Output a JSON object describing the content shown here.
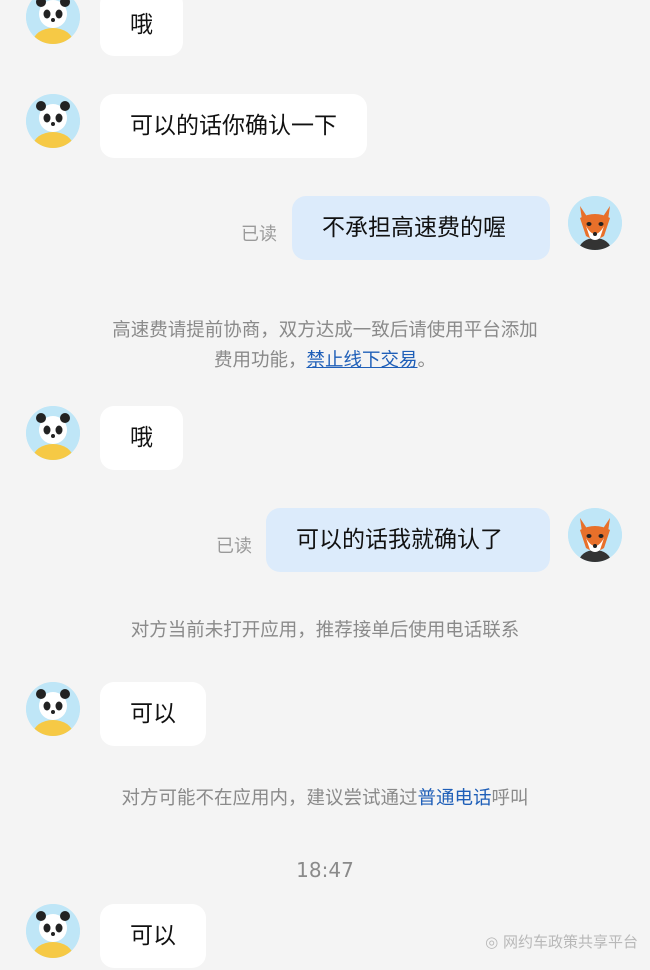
{
  "messages": {
    "m1": {
      "text": "哦"
    },
    "m2": {
      "text": "可以的话你确认一下"
    },
    "m3": {
      "text": "不承担高速费的喔",
      "status": "已读"
    },
    "m4": {
      "text": "哦"
    },
    "m5": {
      "text": "可以的话我就确认了",
      "status": "已读"
    },
    "m6": {
      "text": "可以"
    },
    "m7": {
      "text": "可以"
    }
  },
  "notices": {
    "n1": {
      "line1": "高速费请提前协商，双方达成一致后请使用平台添加",
      "line2_prefix": "费用功能，",
      "line2_link": "禁止线下交易",
      "line2_suffix": "。"
    },
    "n2": {
      "text": "对方当前未打开应用，推荐接单后使用电话联系"
    },
    "n3": {
      "prefix": "对方可能不在应用内，建议尝试通过",
      "link": "普通电话",
      "suffix": "呼叫"
    }
  },
  "timestamp": "18:47",
  "watermark": "网约车政策共享平台",
  "icons": {
    "incoming_avatar": "panda-avatar-icon",
    "outgoing_avatar": "fox-avatar-icon"
  },
  "colors": {
    "outgoing_bubble": "#dcebfb",
    "incoming_bubble": "#ffffff",
    "link": "#1f5fb8",
    "background": "#f4f4f4"
  }
}
